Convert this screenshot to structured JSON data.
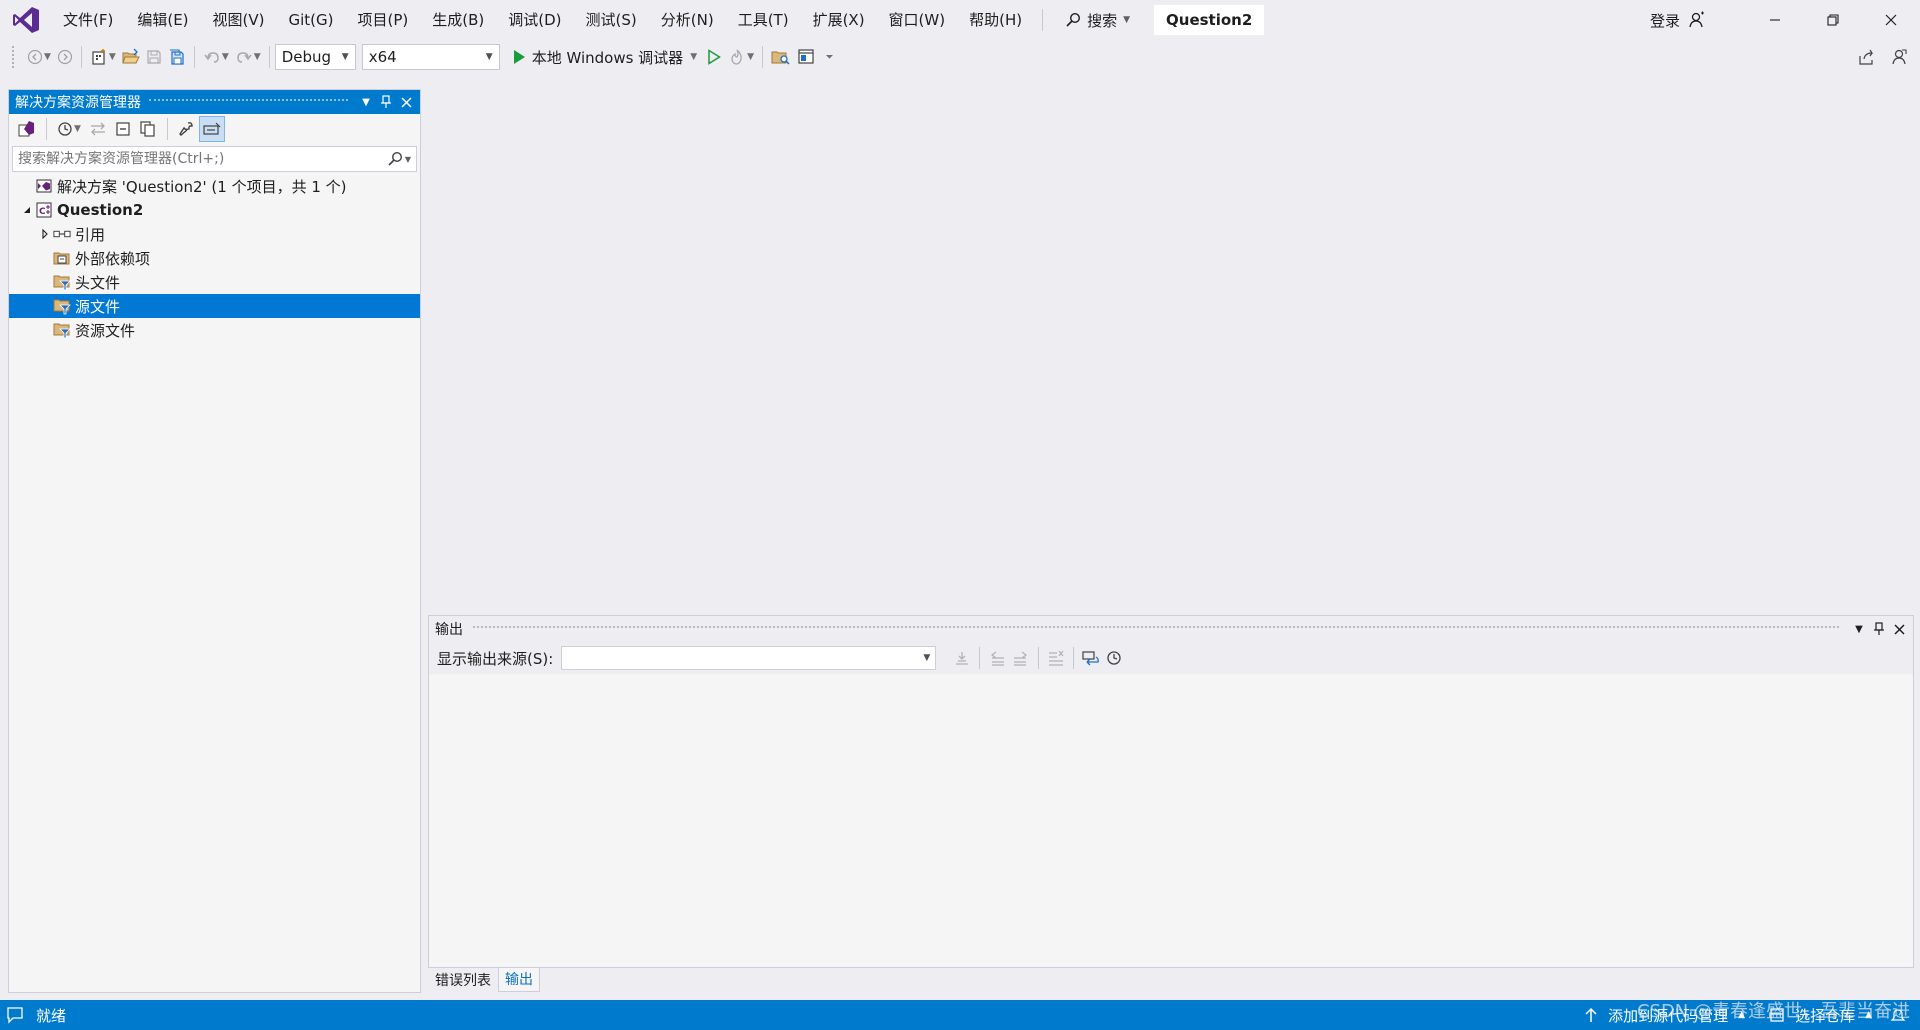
{
  "menu": [
    {
      "id": "file",
      "label": "文件(F)"
    },
    {
      "id": "edit",
      "label": "编辑(E)"
    },
    {
      "id": "view",
      "label": "视图(V)"
    },
    {
      "id": "git",
      "label": "Git(G)"
    },
    {
      "id": "project",
      "label": "项目(P)"
    },
    {
      "id": "build",
      "label": "生成(B)"
    },
    {
      "id": "debug",
      "label": "调试(D)"
    },
    {
      "id": "test",
      "label": "测试(S)"
    },
    {
      "id": "analyze",
      "label": "分析(N)"
    },
    {
      "id": "tools",
      "label": "工具(T)"
    },
    {
      "id": "extensions",
      "label": "扩展(X)"
    },
    {
      "id": "window",
      "label": "窗口(W)"
    },
    {
      "id": "help",
      "label": "帮助(H)"
    }
  ],
  "titlebar": {
    "search_label": "搜索",
    "solution_name": "Question2",
    "signin_label": "登录"
  },
  "toolbar": {
    "configuration": "Debug",
    "platform": "x64",
    "run_label": "本地 Windows 调试器"
  },
  "solution_explorer": {
    "title": "解决方案资源管理器",
    "search_placeholder": "搜索解决方案资源管理器(Ctrl+;)",
    "tree": [
      {
        "label": "解决方案 'Question2' (1 个项目，共 1 个)",
        "level": 0,
        "arrow": "",
        "icon": "solution-icon",
        "bold": false,
        "selected": false
      },
      {
        "label": "Question2",
        "level": 0,
        "arrow": "expanded",
        "icon": "project-icon",
        "bold": true,
        "selected": false
      },
      {
        "label": "引用",
        "level": 1,
        "arrow": "collapsed",
        "icon": "references-icon",
        "bold": false,
        "selected": false
      },
      {
        "label": "外部依赖项",
        "level": 1,
        "arrow": "",
        "icon": "external-deps-icon",
        "bold": false,
        "selected": false
      },
      {
        "label": "头文件",
        "level": 1,
        "arrow": "",
        "icon": "filter-folder-icon",
        "bold": false,
        "selected": false
      },
      {
        "label": "源文件",
        "level": 1,
        "arrow": "",
        "icon": "filter-folder-icon",
        "bold": false,
        "selected": true
      },
      {
        "label": "资源文件",
        "level": 1,
        "arrow": "",
        "icon": "filter-folder-icon",
        "bold": false,
        "selected": false
      }
    ]
  },
  "output": {
    "title": "输出",
    "source_label": "显示输出来源(S):",
    "source_value": ""
  },
  "bottom_tabs": [
    {
      "label": "错误列表",
      "active": false
    },
    {
      "label": "输出",
      "active": true
    }
  ],
  "status": {
    "ready": "就绪",
    "add_source_control": "添加到源代码管理",
    "select_repo": "选择仓库"
  },
  "watermark": "CSDN @青春逢盛世，吾辈当奋进",
  "colors": {
    "accent": "#007acc",
    "selection": "#0078d4",
    "run_green": "#1a9c3a",
    "vs_purple": "#68217a"
  }
}
